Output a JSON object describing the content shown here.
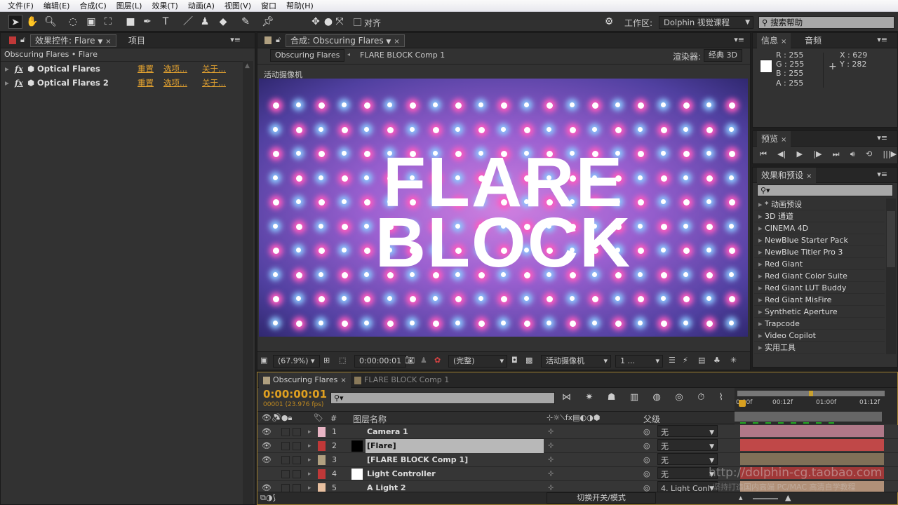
{
  "menu": [
    "文件(F)",
    "编辑(E)",
    "合成(C)",
    "图层(L)",
    "效果(T)",
    "动画(A)",
    "视图(V)",
    "窗口",
    "帮助(H)"
  ],
  "toolbar": {
    "snap_label": "对齐",
    "workspace_label": "工作区:",
    "workspace_value": "Dolphin 视觉课程",
    "search_placeholder": "搜索帮助"
  },
  "effect_controls": {
    "tab": "效果控件: Flare",
    "tab2": "项目",
    "breadcrumb": "Obscuring Flares • Flare",
    "effects": [
      {
        "name": "Optical Flares",
        "reset": "重置",
        "options": "选项...",
        "about": "关于..."
      },
      {
        "name": "Optical Flares 2",
        "reset": "重置",
        "options": "选项...",
        "about": "关于..."
      }
    ]
  },
  "comp": {
    "tab": "合成: Obscuring Flares",
    "crumbs": [
      "Obscuring Flares",
      "FLARE BLOCK Comp 1"
    ],
    "renderer_label": "渲染器:",
    "renderer": "经典 3D",
    "view_label": "活动摄像机",
    "title_line1": "FLARE",
    "title_line2": "BLOCK",
    "zoom": "(67.9%)",
    "time": "0:00:00:01",
    "quality": "(完整)",
    "camera": "活动摄像机",
    "views": "1 ..."
  },
  "info": {
    "tab": "信息",
    "tab2": "音频",
    "r": "R : 255",
    "g": "G : 255",
    "b": "B : 255",
    "a": "A : 255",
    "x": "X : 629",
    "y": "Y : 282",
    "swatch": "#ffffff"
  },
  "preview": {
    "tab": "预览"
  },
  "effects_presets": {
    "tab": "效果和预设",
    "items": [
      "* 动画预设",
      "3D 通道",
      "CINEMA 4D",
      "NewBlue Starter Pack",
      "NewBlue Titler Pro 3",
      "Red Giant",
      "Red Giant Color Suite",
      "Red Giant LUT Buddy",
      "Red Giant MisFire",
      "Synthetic Aperture",
      "Trapcode",
      "Video Copilot",
      "实用工具"
    ]
  },
  "timeline": {
    "tabs": [
      "Obscuring Flares",
      "FLARE BLOCK Comp 1"
    ],
    "timecode": "0:00:00:01",
    "frame_info": "00001 (23.976 fps)",
    "col_name": "图层名称",
    "col_parent": "父级",
    "col_num": "#",
    "ruler": [
      "0:00f",
      "00:12f",
      "01:00f",
      "01:12f"
    ],
    "toggle_label": "切换开关/模式",
    "layers": [
      {
        "num": "1",
        "name": "Camera 1",
        "label": "#e8b4c4",
        "bar": "#b07888",
        "parent": "无"
      },
      {
        "num": "2",
        "name": "[Flare]",
        "label": "#c03838",
        "bar": "#c04848",
        "parent": "无"
      },
      {
        "num": "3",
        "name": "[FLARE BLOCK Comp 1]",
        "label": "#b0a080",
        "bar": "#807058",
        "parent": "无"
      },
      {
        "num": "4",
        "name": "Light Controller",
        "label": "#c03838",
        "bar": "#a03838",
        "parent": "无"
      },
      {
        "num": "5",
        "name": "A Light 2",
        "label": "#e8c0a0",
        "bar": "#b09078",
        "parent": "4. Light Conl"
      }
    ]
  },
  "watermark": "http://dolphin-cg.taobao.com",
  "watermark2": "坚持打造国内高端 PC/MAC 高清自学教程"
}
